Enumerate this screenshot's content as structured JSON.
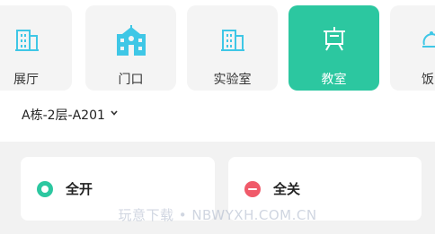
{
  "tiles": [
    {
      "label": "展厅",
      "icon": "building-icon"
    },
    {
      "label": "门口",
      "icon": "school-gate-icon"
    },
    {
      "label": "实验室",
      "icon": "building-icon"
    },
    {
      "label": "教室",
      "icon": "blackboard-icon",
      "active": true
    },
    {
      "label": "饭",
      "icon": "dining-icon"
    }
  ],
  "location": {
    "label": "A栋-2层-A201"
  },
  "actions": {
    "all_on": "全开",
    "all_off": "全关"
  },
  "watermark": "玩意下载 • NBWYXH.COM.CN",
  "colors": {
    "accent": "#2cc7a0",
    "off": "#f05a6a",
    "icon": "#3fc7e6",
    "tile_bg": "#f4f4f4"
  }
}
